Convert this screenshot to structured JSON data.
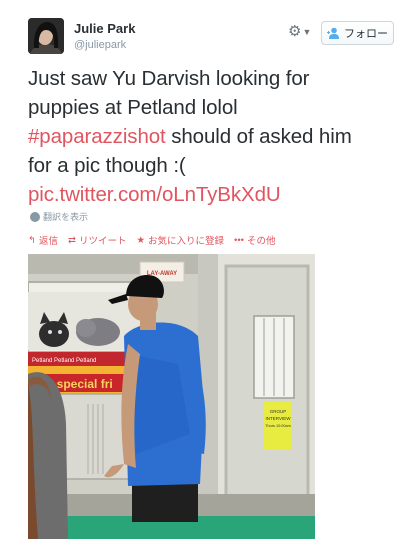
{
  "user": {
    "name": "Julie Park",
    "handle": "@juliepark"
  },
  "controls": {
    "gear_icon": "gear-icon",
    "follow_label": "フォロー"
  },
  "tweet": {
    "line1": "Just saw Yu Darvish looking for",
    "line2": "puppies at Petland lolol",
    "hashtag": "#paparazzishot",
    "line3_rest": " should of asked him",
    "line4": "for a pic though :(",
    "pic_link": "pic.twitter.com/oLnTyBkXdU"
  },
  "translate_label": "翻訳を表示",
  "actions": {
    "reply": "返信",
    "retweet": "リツイート",
    "favorite": "お気に入りに登録",
    "more": "その他"
  },
  "photo": {
    "sign_layaway": "LAY-AWAY",
    "sign_special": "our special fri",
    "sign_petland_strip": "Petland  Petland  Petland",
    "notice_line1": "GROUP",
    "notice_line2": "INTERVIEW",
    "notice_line3": "Thurs 10:00am"
  },
  "colors": {
    "accent": "#e0555f",
    "muted": "#8899a6",
    "follow_icon": "#55acee"
  }
}
